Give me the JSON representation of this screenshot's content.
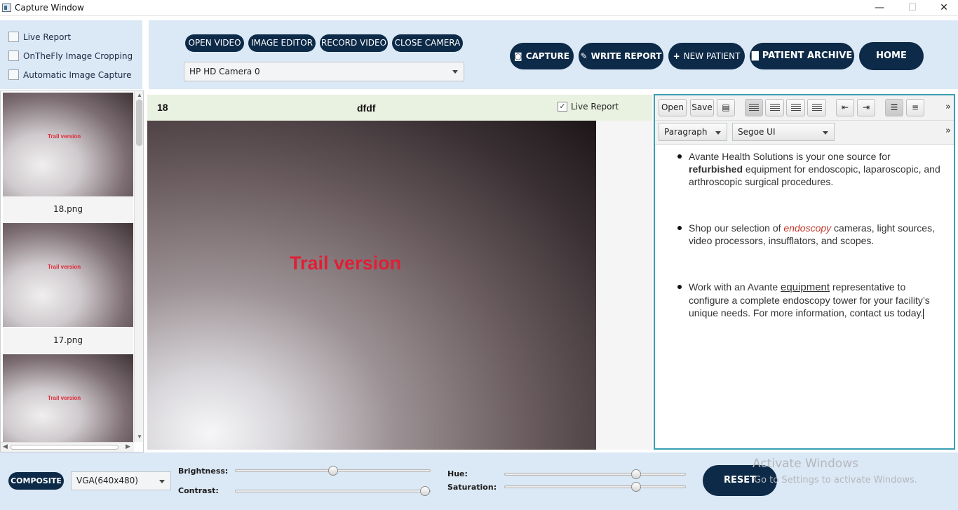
{
  "window": {
    "title": "Capture Window",
    "minimize": "—",
    "maximize": "☐",
    "close": "✕"
  },
  "options": {
    "live_report": "Live Report",
    "onthefly_cropping": "OnTheFly Image Cropping",
    "auto_capture": "Automatic Image Capture"
  },
  "camera": {
    "buttons": [
      "OPEN VIDEO",
      "IMAGE EDITOR",
      "RECORD VIDEO",
      "CLOSE CAMERA"
    ],
    "device": "HP HD Camera 0"
  },
  "actions": {
    "capture": "CAPTURE",
    "write_report": "WRITE REPORT",
    "new_patient": "NEW PATIENT",
    "patient_archive": "PATIENT ARCHIVE",
    "home": "HOME"
  },
  "thumbnails": [
    {
      "label": "18.png",
      "watermark": "Trail version"
    },
    {
      "label": "17.png",
      "watermark": "Trail version"
    },
    {
      "label": "",
      "watermark": "Trail version"
    }
  ],
  "preview": {
    "number": "18",
    "name": "dfdf",
    "live_report": "Live Report",
    "live_report_checked": true,
    "watermark": "Trail version"
  },
  "editor": {
    "open": "Open",
    "save": "Save",
    "paragraph": "Paragraph",
    "font": "Segoe UI",
    "more": "»",
    "bullets": [
      {
        "pre": "Avante Health Solutions is your one source for ",
        "bold": "refurbished",
        "post": " equipment for endoscopic, laparoscopic, and arthroscopic surgical procedures."
      },
      {
        "pre": "Shop our selection of ",
        "italic": "endoscopy",
        "post": " cameras, light sources, video processors, insufflators, and scopes."
      },
      {
        "pre": "Work with an Avante ",
        "underline": "equipment",
        "post": " representative to configure a complete endoscopy tower for your facility’s unique needs. For more information, contact us today."
      }
    ]
  },
  "bottom": {
    "composite": "COMPOSITE",
    "resolution": "VGA(640x480)",
    "brightness_label": "Brightness:",
    "contrast_label": "Contrast:",
    "hue_label": "Hue:",
    "saturation_label": "Saturation:",
    "brightness": 0.5,
    "contrast": 1.0,
    "hue": 0.74,
    "saturation": 0.74,
    "reset": "RESET"
  },
  "os_watermark": {
    "line1": "Activate Windows",
    "line2": "Go to Settings to activate Windows."
  }
}
